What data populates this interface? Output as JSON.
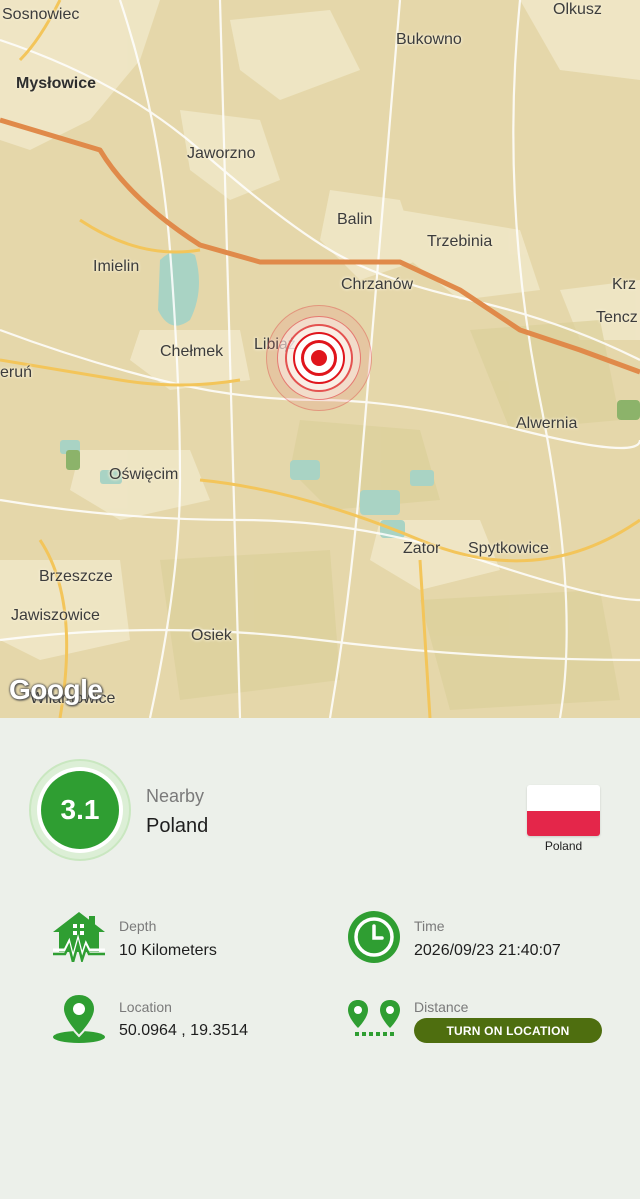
{
  "map": {
    "attribution": "Google",
    "cities": [
      {
        "name": "Sosnowiec",
        "big": false
      },
      {
        "name": "Olkusz",
        "big": false
      },
      {
        "name": "Bukowno",
        "big": false
      },
      {
        "name": "Mysłowice",
        "big": true
      },
      {
        "name": "Jaworzno",
        "big": false
      },
      {
        "name": "Balin",
        "big": false
      },
      {
        "name": "Trzebinia",
        "big": false
      },
      {
        "name": "Imielin",
        "big": false
      },
      {
        "name": "Chrzanów",
        "big": false
      },
      {
        "name": "Krz",
        "big": false
      },
      {
        "name": "Tencz",
        "big": false
      },
      {
        "name": "Chełmek",
        "big": false
      },
      {
        "name": "Libiąż",
        "big": false
      },
      {
        "name": "eruń",
        "big": false
      },
      {
        "name": "Alwernia",
        "big": false
      },
      {
        "name": "Oświęcim",
        "big": false
      },
      {
        "name": "Zator",
        "big": false
      },
      {
        "name": "Spytkowice",
        "big": false
      },
      {
        "name": "Brzeszcze",
        "big": false
      },
      {
        "name": "Jawiszowice",
        "big": false
      },
      {
        "name": "Osiek",
        "big": false
      },
      {
        "name": "Wilamowice",
        "big": false
      }
    ],
    "marker_icon": "epicenter-pulse-icon"
  },
  "quake": {
    "magnitude": "3.1",
    "region_label": "Nearby",
    "country": "Poland",
    "flag_label": "Poland",
    "flag_colors": [
      "#ffffff",
      "#e4264a"
    ]
  },
  "details": {
    "depth": {
      "label": "Depth",
      "value": "10 Kilometers",
      "icon": "house-seismic-icon"
    },
    "time": {
      "label": "Time",
      "value": "2026/09/23 21:40:07",
      "icon": "clock-icon"
    },
    "location": {
      "label": "Location",
      "value": "50.0964 , 19.3514",
      "icon": "map-pin-icon"
    },
    "distance": {
      "label": "Distance",
      "button": "TURN ON LOCATION",
      "icon": "distance-pins-icon"
    }
  },
  "colors": {
    "accent_green": "#2f9e32",
    "button_olive": "#4e6e0f",
    "marker_red": "#e0151c"
  }
}
